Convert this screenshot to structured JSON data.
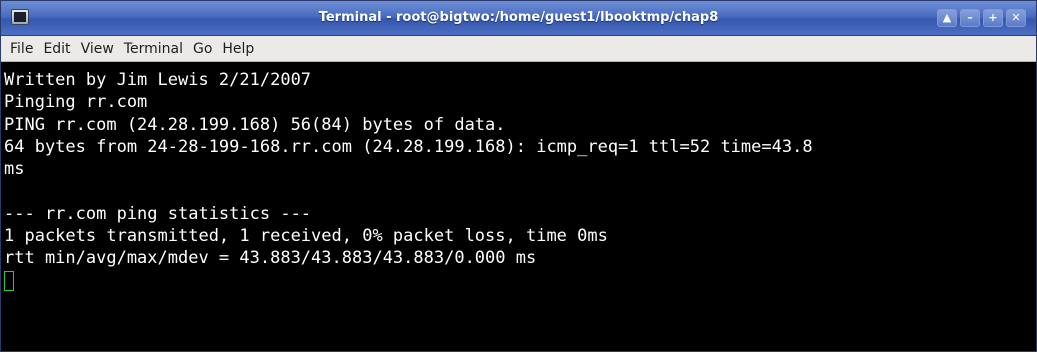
{
  "window": {
    "title": "Terminal - root@bigtwo:/home/guest1/lbooktmp/chap8",
    "app_icon": "terminal-icon",
    "buttons": [
      {
        "name": "shade",
        "glyph": "▲"
      },
      {
        "name": "minimize",
        "glyph": "–"
      },
      {
        "name": "maximize",
        "glyph": "+"
      },
      {
        "name": "close",
        "glyph": "✕"
      }
    ]
  },
  "menubar": {
    "items": [
      "File",
      "Edit",
      "View",
      "Terminal",
      "Go",
      "Help"
    ]
  },
  "terminal": {
    "lines": [
      "Written by Jim Lewis 2/21/2007",
      "Pinging rr.com",
      "PING rr.com (24.28.199.168) 56(84) bytes of data.",
      "64 bytes from 24-28-199-168.rr.com (24.28.199.168): icmp_req=1 ttl=52 time=43.8",
      "ms",
      "",
      "--- rr.com ping statistics ---",
      "1 packets transmitted, 1 received, 0% packet loss, time 0ms",
      "rtt min/avg/max/mdev = 43.883/43.883/43.883/0.000 ms"
    ],
    "colors": {
      "background": "#000000",
      "foreground": "#ffffff",
      "cursor": "#2ec83c"
    }
  }
}
